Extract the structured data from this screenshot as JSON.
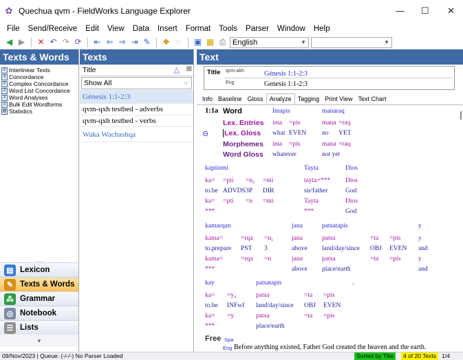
{
  "window": {
    "title": "Quechua qvm - FieldWorks Language Explorer",
    "min": "—",
    "max": "☐",
    "close": "✕"
  },
  "menu": [
    "File",
    "Send/Receive",
    "Edit",
    "View",
    "Data",
    "Insert",
    "Format",
    "Tools",
    "Parser",
    "Window",
    "Help"
  ],
  "toolbar": {
    "writing_system": "English",
    "combo2": ""
  },
  "left": {
    "header": "Texts & Words",
    "items": [
      "Interlinear Texts",
      "Concordance",
      "Complex Concordance",
      "Word List Concordance",
      "Word Analyses",
      "Bulk Edit Wordforms",
      "Statistics"
    ],
    "grip": ".....",
    "areas": [
      "Lexicon",
      "Texts & Words",
      "Grammar",
      "Notebook",
      "Lists"
    ],
    "scroll_arrow": "▾"
  },
  "middle": {
    "header": "Texts",
    "column_title": "Title",
    "filter": "Show All",
    "records": [
      "Génesis 1:1-2:3",
      "qvm-qxh testbed - adverbs",
      "qvm-qxh testbed - verbs",
      "Waka Wachashqa"
    ]
  },
  "right": {
    "header": "Text",
    "title_label": "Title",
    "title_ws1": "qvm-akh",
    "title_val1": "Génesis 1:1-2:3",
    "title_ws2": "Eng",
    "title_val2": "Genesis 1:1-2:3",
    "tabs": [
      "Info",
      "Baseline",
      "Gloss",
      "Analyze",
      "Tagging",
      "Print View",
      "Text Chart"
    ],
    "selected_tab": "Analyze",
    "segment_number": "1:1a",
    "row_labels": {
      "word": "Word",
      "lex_entries": "Lex. Entries",
      "lex_gloss": "Lex. Gloss",
      "morphemes": "Morphemes",
      "word_gloss": "Word Gloss"
    },
    "focus": {
      "word": "Imapis",
      "word2": "manaraq",
      "lex": [
        "ima",
        "=pis",
        "mana",
        "=raq"
      ],
      "gloss": [
        "what",
        "EVEN",
        "no",
        "YET"
      ],
      "morph": [
        "ima",
        "=pis",
        "mana",
        "=raq"
      ],
      "wgloss": [
        "whatever",
        "not yet"
      ]
    },
    "bundle1": {
      "words": [
        "kaptinmi",
        "Tayta",
        "Dios"
      ],
      "lex": [
        "ka=",
        "=pti",
        "=n₂",
        "=mi",
        "tayta+***",
        "Dios"
      ],
      "gloss": [
        "to.be",
        "ADVDS",
        "3P",
        "DIR",
        "sir/father",
        "God"
      ],
      "morph": [
        "ka=",
        "=pti",
        "=n",
        "=mi",
        "Tayta",
        "Dios"
      ],
      "wgloss": [
        "***",
        "***",
        "God"
      ]
    },
    "bundle2": {
      "words": [
        "kamarqan",
        "jana",
        "patsatapis",
        "y"
      ],
      "lex": [
        "kama=",
        "=rqa",
        "=n₁",
        "jana",
        "patsa",
        "=ta",
        "=pis",
        "y"
      ],
      "gloss": [
        "to.prepare",
        "PST",
        "3",
        "above",
        "land/day/since",
        "OBJ",
        "EVEN",
        "and"
      ],
      "morph": [
        "kama=",
        "=rqa",
        "=n",
        "jana",
        "patsa",
        "=ta",
        "=pis",
        "y"
      ],
      "wgloss": [
        "***",
        "above",
        "place/earth",
        "and"
      ]
    },
    "bundle3": {
      "words": [
        "kay",
        "patsatapis",
        "."
      ],
      "lex": [
        "ka=",
        "=y₄",
        "patsa",
        "=ta",
        "=pis"
      ],
      "gloss": [
        "to.be",
        "INFwf",
        "land/day/since",
        "OBJ",
        "EVEN"
      ],
      "morph": [
        "ka=",
        "=y",
        "patsa",
        "=ta",
        "=pis"
      ],
      "wgloss": [
        "***",
        "place/earth"
      ]
    },
    "free": {
      "label": "Free",
      "ws_spa": "Spa",
      "ws_eng": "Eng",
      "text": "Before anything existed, Father God created the heaven and the earth."
    }
  },
  "status": {
    "date": "09/Nov/2023",
    "queue": "Queue: (-/-/-) No Parser Loaded",
    "sorted": "Sorted by Title",
    "count": "4 of 20 Texts",
    "page": "1/4"
  },
  "colors": {
    "header_blue": "#3f6aa6",
    "analysis_blue": "#2c2ad4",
    "magenta": "#a0149c",
    "status_green": "#1ec11e",
    "status_yellow": "#fff200"
  }
}
